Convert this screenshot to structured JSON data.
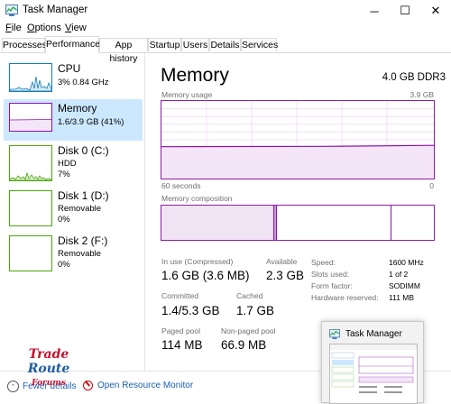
{
  "window": {
    "title": "Task Manager",
    "minimize": "─",
    "maximize": "☐",
    "close": "✕"
  },
  "menu": {
    "file_u": "F",
    "file_rest": "ile",
    "options_u": "O",
    "options_rest": "ptions",
    "view_u": "V",
    "view_rest": "iew"
  },
  "tabs": [
    "Processes",
    "Performance",
    "App history",
    "Startup",
    "Users",
    "Details",
    "Services"
  ],
  "active_tab": "Performance",
  "sidebar": {
    "items": [
      {
        "name": "CPU",
        "sub1": "3%  0.84 GHz",
        "sub2": "",
        "color": "#117dbb"
      },
      {
        "name": "Memory",
        "sub1": "1.6/3.9 GB (41%)",
        "sub2": "",
        "color": "#8b12ae"
      },
      {
        "name": "Disk 0 (C:)",
        "sub1": "HDD",
        "sub2": "7%",
        "color": "#4da60c"
      },
      {
        "name": "Disk 1 (D:)",
        "sub1": "Removable",
        "sub2": "0%",
        "color": "#4da60c"
      },
      {
        "name": "Disk 2 (F:)",
        "sub1": "Removable",
        "sub2": "0%",
        "color": "#4da60c"
      }
    ]
  },
  "main": {
    "title": "Memory",
    "spec": "4.0 GB DDR3",
    "usage_label": "Memory usage",
    "usage_max": "3.9 GB",
    "time_left": "60 seconds",
    "time_right": "0",
    "composition_label": "Memory composition",
    "usage_fraction": 0.41
  },
  "stats": {
    "in_use_label": "In use (Compressed)",
    "in_use_value": "1.6 GB (3.6 MB)",
    "available_label": "Available",
    "available_value": "2.3 GB",
    "committed_label": "Committed",
    "committed_value": "1.4/5.3 GB",
    "cached_label": "Cached",
    "cached_value": "1.7 GB",
    "paged_label": "Paged pool",
    "paged_value": "114 MB",
    "nonpaged_label": "Non-paged pool",
    "nonpaged_value": "66.9 MB"
  },
  "details": [
    {
      "key": "Speed:",
      "value": "1600 MHz"
    },
    {
      "key": "Slots used:",
      "value": "1 of 2"
    },
    {
      "key": "Form factor:",
      "value": "SODIMM"
    },
    {
      "key": "Hardware reserved:",
      "value": "111 MB"
    }
  ],
  "footer": {
    "fewer_details": "Fewer details",
    "resource_monitor": "Open Resource Monitor"
  },
  "watermark": {
    "line1": "Trade",
    "line2": "Route",
    "line3": "Forums"
  },
  "preview": {
    "title": "Task Manager"
  },
  "colors": {
    "memory_accent": "#8b12ae",
    "selected_bg": "#cce8ff",
    "link": "#1a5fb4"
  }
}
